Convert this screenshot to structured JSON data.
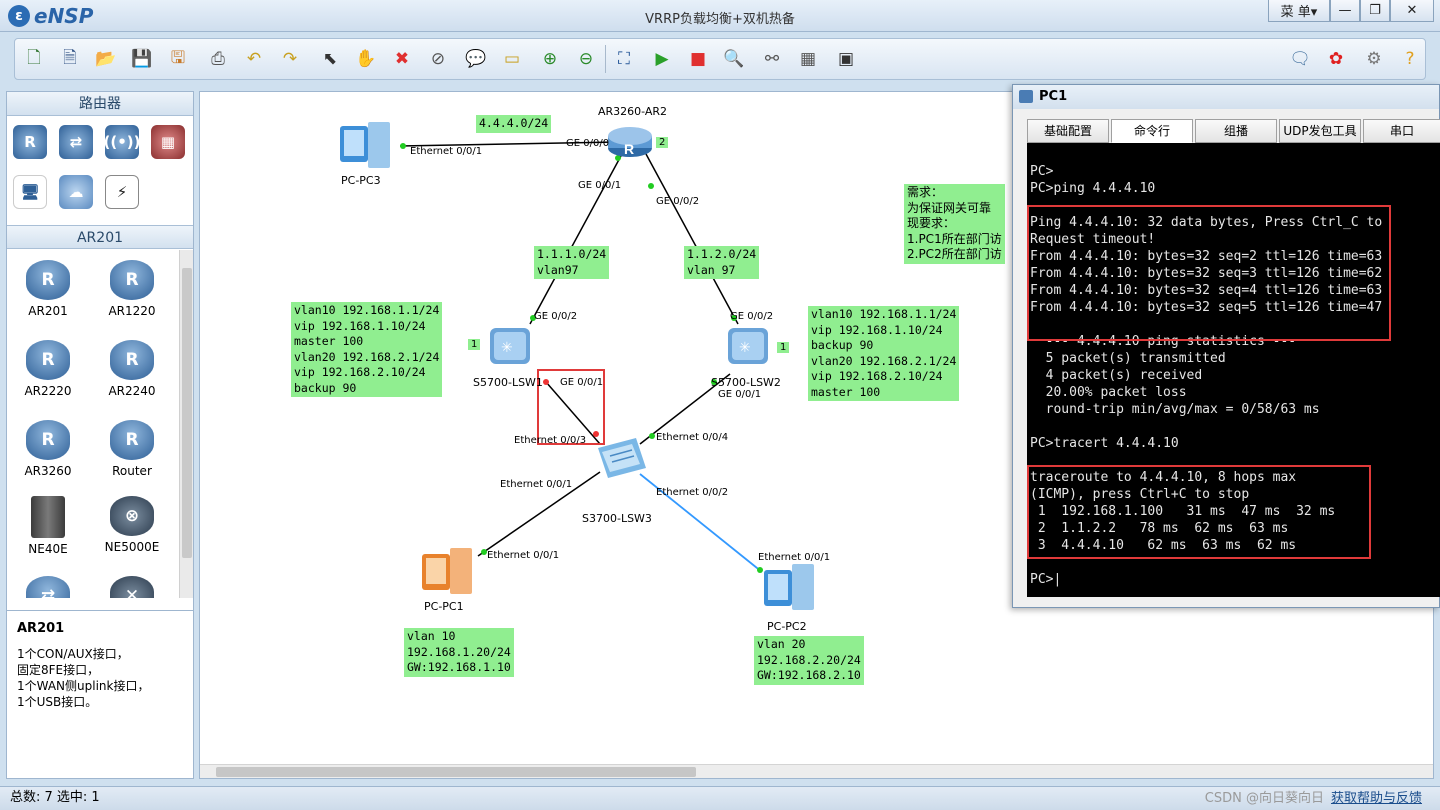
{
  "app": {
    "name": "eNSP",
    "title": "VRRP负载均衡+双机热备",
    "menu_label": "菜 单▾"
  },
  "window_controls": {
    "minimize": "—",
    "restore": "❐",
    "close": "✕"
  },
  "toolbar": {
    "left_icons": [
      "new-topology-icon",
      "new-template-icon",
      "open-icon",
      "save-icon",
      "save-as-icon",
      "print-icon",
      "undo-icon",
      "redo-icon",
      "select-icon",
      "hand-drag-icon",
      "delete-icon",
      "delete-link-icon",
      "text-note-icon",
      "rectangle-icon",
      "zoom-in-icon",
      "zoom-out-icon",
      "fit-window-icon",
      "start-device-icon",
      "stop-device-icon",
      "capture-icon",
      "topology-icon",
      "grid-icon",
      "screenshot-icon"
    ],
    "right_icons": [
      "chat-icon",
      "huawei-logo-icon",
      "settings-icon",
      "help-icon"
    ]
  },
  "left_panel": {
    "category_header": "路由器",
    "category_icons": [
      "router-category-icon",
      "switch-category-icon",
      "wireless-category-icon",
      "firewall-category-icon",
      "pc-category-icon",
      "cloud-category-icon",
      "cable-category-icon"
    ],
    "device_header": "AR201",
    "devices": [
      "AR201",
      "AR1220",
      "AR2220",
      "AR2240",
      "AR3260",
      "Router",
      "NE40E",
      "NE5000E",
      "",
      ""
    ],
    "description": {
      "title": "AR201",
      "lines": [
        "1个CON/AUX接口，",
        "固定8FE接口，",
        "1个WAN侧uplink接口，",
        "1个USB接口。"
      ]
    }
  },
  "topology": {
    "devices": {
      "ar2": "AR3260-AR2",
      "lsw1": "S5700-LSW1",
      "lsw2": "S5700-LSW2",
      "lsw3": "S3700-LSW3",
      "pc3": "PC-PC3",
      "pc1": "PC-PC1",
      "pc2": "PC-PC2"
    },
    "badges": {
      "ar2": "2",
      "lsw1": "1",
      "lsw2": "1"
    },
    "ports": {
      "pc3_e001": "Ethernet 0/0/1",
      "ar2_ge000": "GE 0/0/0",
      "ar2_ge001": "GE 0/0/1",
      "ar2_ge002": "GE 0/0/2",
      "lsw1_ge002": "GE 0/0/2",
      "lsw1_ge001": "GE 0/0/1",
      "lsw2_ge002": "GE 0/0/2",
      "lsw2_ge001": "GE 0/0/1",
      "lsw3_e003": "Ethernet 0/0/3",
      "lsw3_e004": "Ethernet 0/0/4",
      "lsw3_e001": "Ethernet 0/0/1",
      "lsw3_e002": "Ethernet 0/0/2",
      "pc1_e001": "Ethernet 0/0/1",
      "pc2_e001": "Ethernet 0/0/1"
    },
    "notes": {
      "net_4": "4.4.4.0/24",
      "link_1": "1.1.1.0/24\nvlan97",
      "link_2": "1.1.2.0/24\nvlan 97",
      "lsw1": "vlan10 192.168.1.1/24\nvip 192.168.1.10/24\nmaster 100\nvlan20 192.168.2.1/24\nvip 192.168.2.10/24\nbackup 90",
      "lsw2": "vlan10 192.168.1.1/24\nvip 192.168.1.10/24\nbackup 90\nvlan20 192.168.2.1/24\nvip 192.168.2.10/24\nmaster 100",
      "pc1": "vlan 10\n192.168.1.20/24\nGW:192.168.1.10",
      "pc2": "vlan 20\n192.168.2.20/24\nGW:192.168.2.10",
      "requirement": "需求：\n为保证网关可靠\n现要求：\n1.PC1所在部门访\n2.PC2所在部门访"
    }
  },
  "pc1_window": {
    "title": "PC1",
    "tabs": [
      "基础配置",
      "命令行",
      "组播",
      "UDP发包工具",
      "串口"
    ],
    "active_tab": "命令行",
    "console_lines": [
      "PC>",
      "PC>ping 4.4.4.10",
      "",
      "Ping 4.4.4.10: 32 data bytes, Press Ctrl_C to",
      "Request timeout!",
      "From 4.4.4.10: bytes=32 seq=2 ttl=126 time=63",
      "From 4.4.4.10: bytes=32 seq=3 ttl=126 time=62",
      "From 4.4.4.10: bytes=32 seq=4 ttl=126 time=63",
      "From 4.4.4.10: bytes=32 seq=5 ttl=126 time=47",
      "",
      "  --- 4.4.4.10 ping statistics ---",
      "  5 packet(s) transmitted",
      "  4 packet(s) received",
      "  20.00% packet loss",
      "  round-trip min/avg/max = 0/58/63 ms",
      "",
      "PC>tracert 4.4.4.10",
      "",
      "traceroute to 4.4.4.10, 8 hops max",
      "(ICMP), press Ctrl+C to stop",
      " 1  192.168.1.100   31 ms  47 ms  32 ms",
      " 2  1.1.2.2   78 ms  62 ms  63 ms",
      " 3  4.4.4.10   62 ms  63 ms  62 ms",
      "",
      "PC>|"
    ]
  },
  "status": {
    "text": "总数: 7  选中: 1",
    "watermark": "CSDN @向日葵向日",
    "help_link": "获取帮助与反馈"
  },
  "colors": {
    "note_bg": "#90ee90",
    "highlight": "#e03a3a",
    "console_bg": "#000000",
    "link_blue": "#3399ff",
    "port_green": "#22cc22",
    "port_red": "#ee3333"
  }
}
